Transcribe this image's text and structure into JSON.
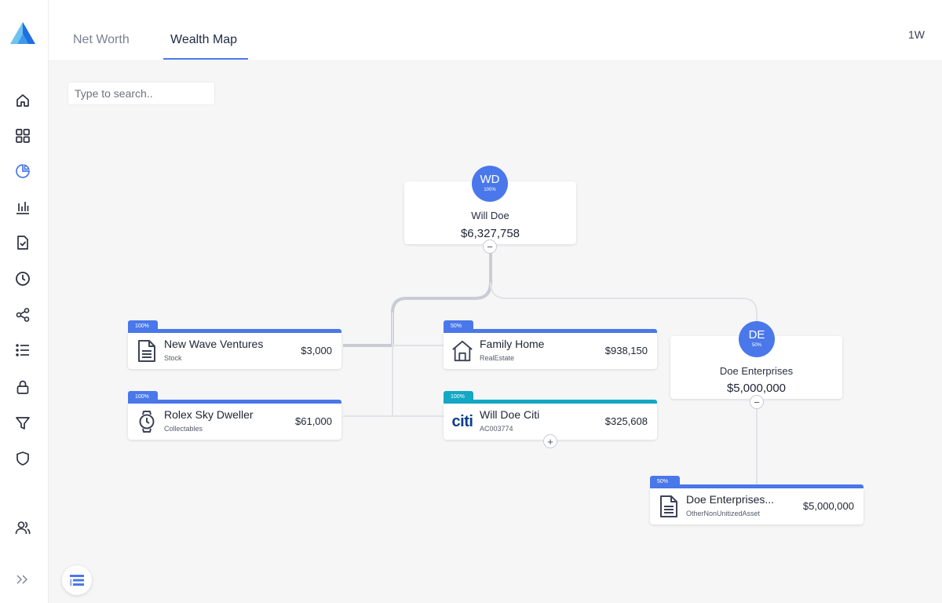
{
  "tabs": [
    {
      "label": "Net Worth"
    },
    {
      "label": "Wealth Map"
    }
  ],
  "period": "1W",
  "search": {
    "placeholder": "Type to search.."
  },
  "colors": {
    "accent": "#4a78ea",
    "teal": "#13a8c4",
    "connector": "#c9ccd4"
  },
  "sidebar": {
    "items": [
      {
        "icon": "home-icon"
      },
      {
        "icon": "dashboard-grid-icon"
      },
      {
        "icon": "pie-chart-icon"
      },
      {
        "icon": "bar-chart-icon"
      },
      {
        "icon": "document-check-icon"
      },
      {
        "icon": "clock-icon"
      },
      {
        "icon": "share-icon"
      },
      {
        "icon": "list-icon"
      },
      {
        "icon": "lock-icon"
      },
      {
        "icon": "filter-icon"
      },
      {
        "icon": "shield-icon"
      },
      {
        "icon": "users-icon"
      },
      {
        "icon": "expand-chevrons-icon"
      }
    ]
  },
  "owners": {
    "will_doe": {
      "initials": "WD",
      "pct": "100%",
      "name": "Will Doe",
      "value": "$6,327,758",
      "toggle": "−"
    },
    "doe_enterprises": {
      "initials": "DE",
      "pct": "50%",
      "name": "Doe Enterprises",
      "value": "$5,000,000",
      "toggle": "−"
    }
  },
  "assets": {
    "new_wave": {
      "pct": "100%",
      "name": "New Wave Ventures",
      "type": "Stock",
      "value": "$3,000",
      "icon": "document-icon"
    },
    "rolex": {
      "pct": "100%",
      "name": "Rolex Sky Dweller",
      "type": "Collectables",
      "value": "$61,000",
      "icon": "watch-icon"
    },
    "family_home": {
      "pct": "50%",
      "name": "Family Home",
      "type": "RealEstate",
      "value": "$938,150",
      "icon": "house-icon"
    },
    "citi": {
      "pct": "100%",
      "name": "Will Doe Citi",
      "type": "AC003774",
      "value": "$325,608",
      "icon": "citi-logo-icon",
      "logo_text": "citi",
      "expand": "+"
    },
    "doe_asset": {
      "pct": "50%",
      "name": "Doe Enterprises...",
      "type": "OtherNonUnitizedAsset",
      "value": "$5,000,000",
      "icon": "document-icon"
    }
  }
}
